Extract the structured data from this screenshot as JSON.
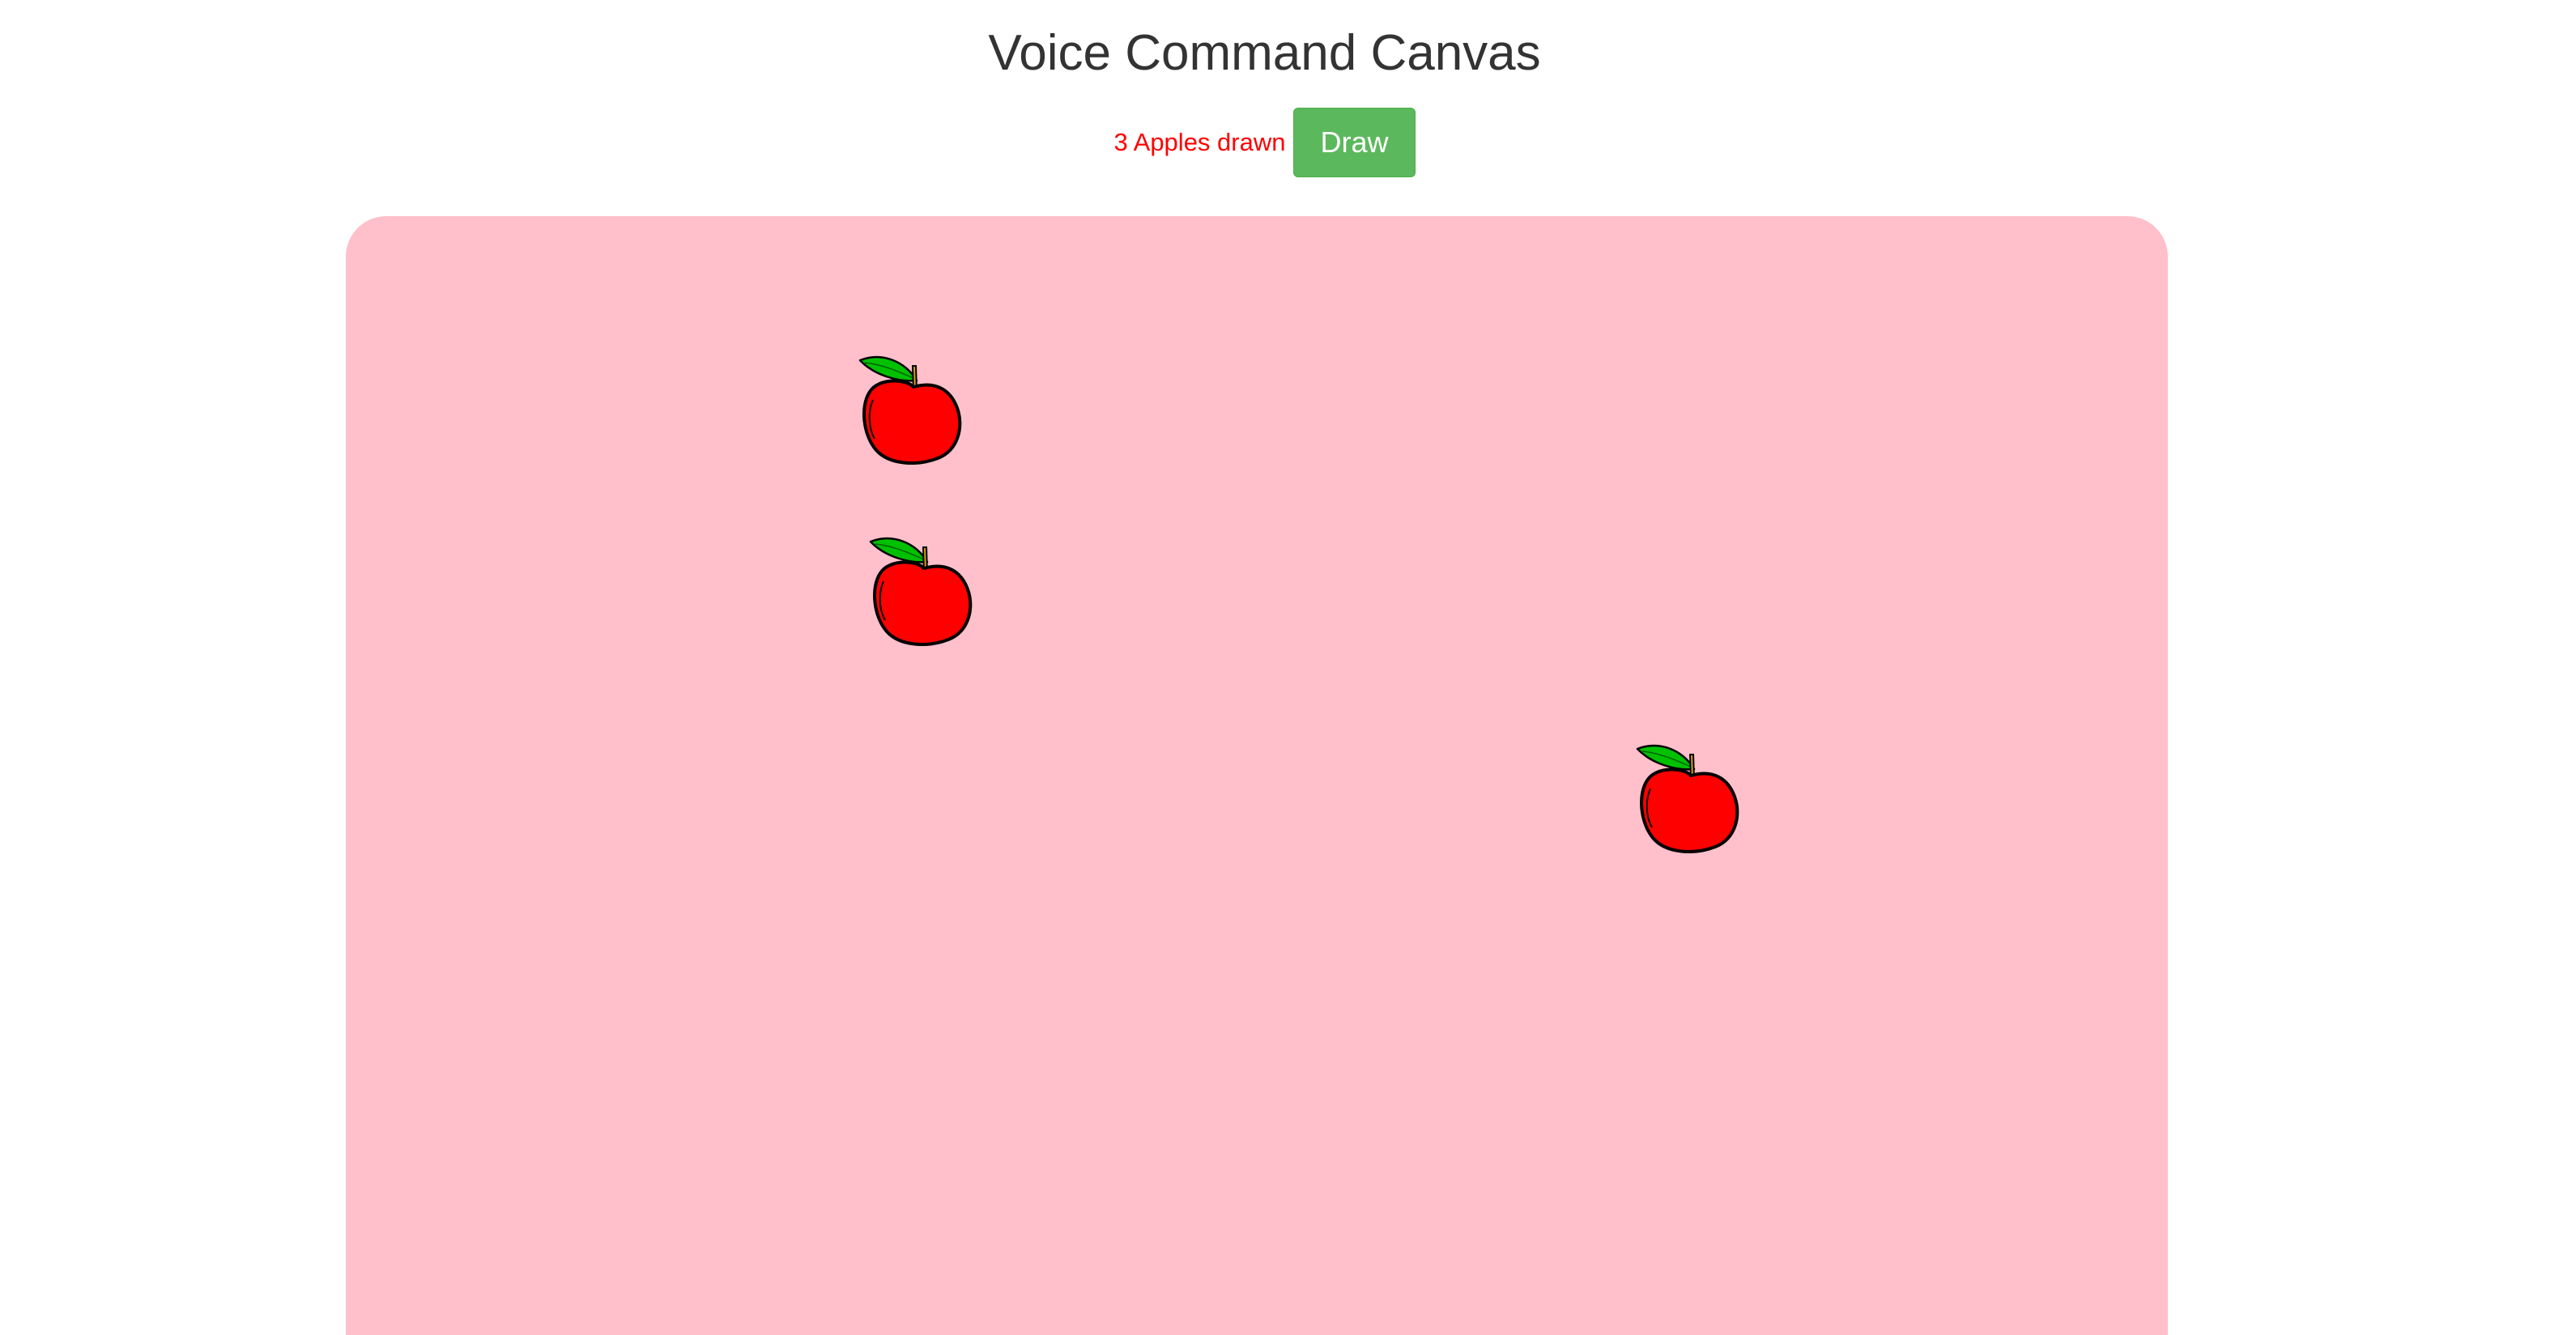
{
  "page": {
    "title": "Voice Command Canvas"
  },
  "controls": {
    "status_text": "3 Apples drawn",
    "draw_label": "Draw"
  },
  "canvas": {
    "background": "#ffc0cb",
    "apples": [
      {
        "icon": "apple-icon"
      },
      {
        "icon": "apple-icon"
      },
      {
        "icon": "apple-icon"
      }
    ]
  },
  "colors": {
    "status_text": "#ff0000",
    "button_bg": "#5cb85c",
    "apple_body": "#ff0000",
    "apple_leaf": "#00c000",
    "apple_stem": "#d4a017"
  }
}
